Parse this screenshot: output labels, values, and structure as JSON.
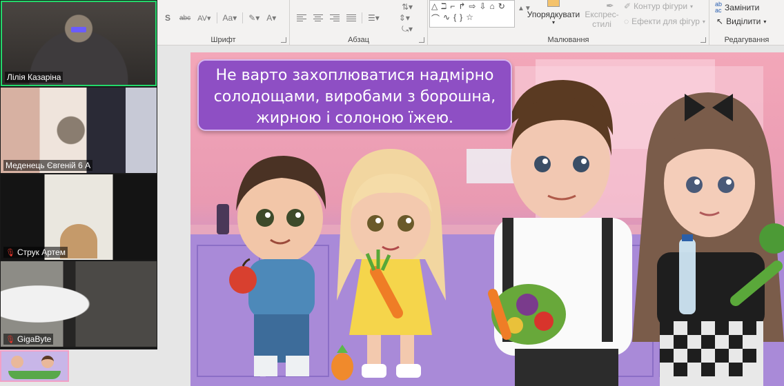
{
  "ribbon": {
    "font_group_label": "Шрифт",
    "paragraph_group_label": "Абзац",
    "drawing_group_label": "Малювання",
    "editing_group_label": "Редагування",
    "arrange_label": "Упорядкувати",
    "quick_styles_label_1": "Експрес-",
    "quick_styles_label_2": "стилі",
    "shape_outline_label": "Контур фігури",
    "shape_effects_label": "Ефекти для фігур",
    "replace_label": "Замінити",
    "select_label": "Виділити"
  },
  "participants": [
    {
      "name": "Лілія Казаріна",
      "muted": false,
      "active": true
    },
    {
      "name": "Меденець Євгеній 6 А",
      "muted": false,
      "active": false
    },
    {
      "name": "Струк Артем",
      "muted": true,
      "active": false
    },
    {
      "name": "GigaByte",
      "muted": true,
      "active": false
    }
  ],
  "slide": {
    "text_line_1": "Не варто захоплюватися надмірно",
    "text_line_2": "солодощами, виробами з борошна,",
    "text_line_3": "жирною і солоною їжею."
  },
  "colors": {
    "active_speaker": "#23d96b",
    "bubble": "#8e4fc4",
    "muted_icon": "#e0352b"
  }
}
